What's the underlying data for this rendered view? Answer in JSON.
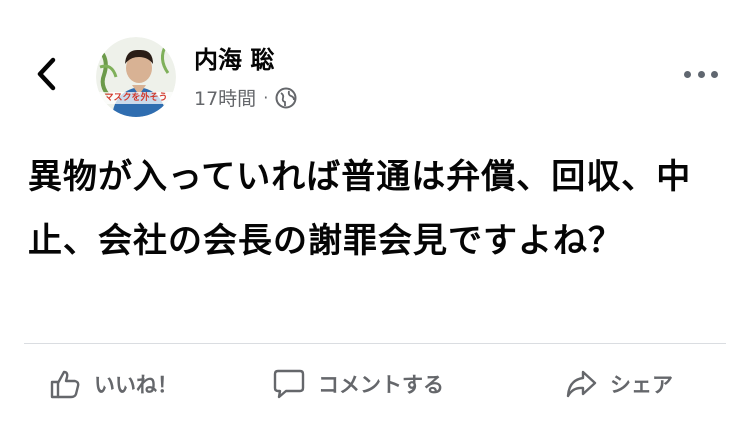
{
  "post": {
    "author": "内海 聡",
    "time": "17時間",
    "separator": "·",
    "visibility_icon": "globe-icon",
    "body": "異物が入っていれば普通は弁償、回収、中止、会社の会長の謝罪会見ですよね？"
  },
  "avatar": {
    "caption": "マスクを外そう"
  },
  "actions": {
    "like_label": "いいね！",
    "comment_label": "コメントする",
    "share_label": "シェア"
  },
  "colors": {
    "text": "#050505",
    "secondary": "#65676b",
    "divider": "#dadde1"
  }
}
